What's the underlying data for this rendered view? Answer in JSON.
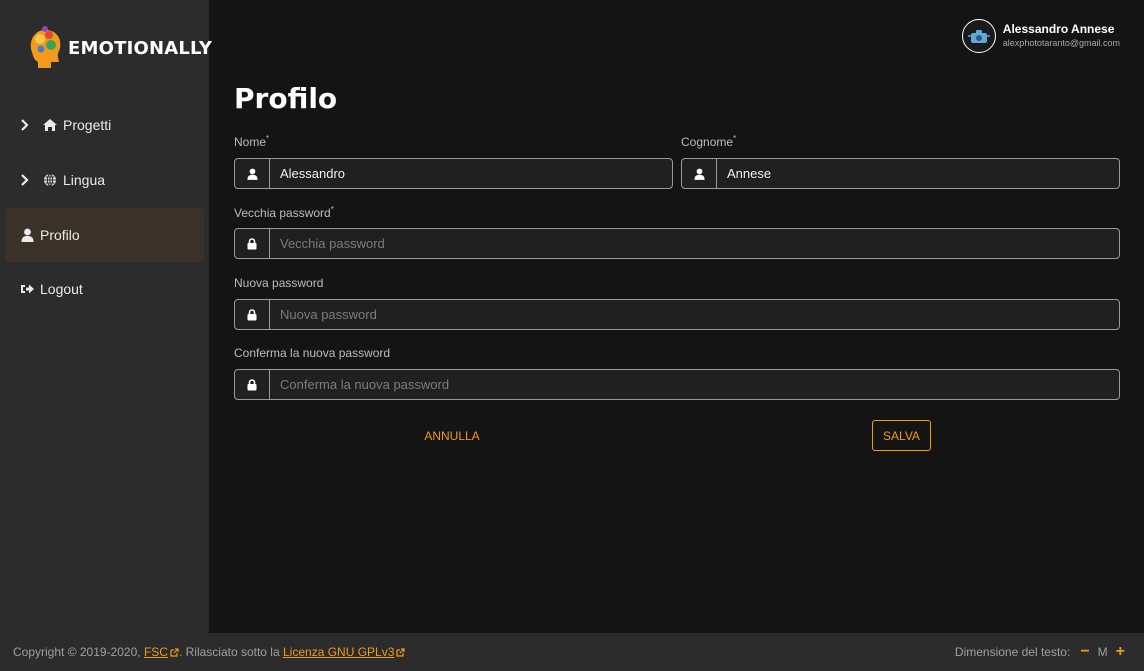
{
  "brand": {
    "name": "EMOTIONALLY"
  },
  "colors": {
    "accent": "#f29a1a",
    "sidebar_bg": "#2c2c2c",
    "page_bg": "#141414"
  },
  "sidebar": {
    "items": [
      {
        "label": "Progetti",
        "icon": "home-icon",
        "expandable": true
      },
      {
        "label": "Lingua",
        "icon": "globe-icon",
        "expandable": true
      },
      {
        "label": "Profilo",
        "icon": "user-icon",
        "active": true
      },
      {
        "label": "Logout",
        "icon": "sign-out-icon"
      }
    ]
  },
  "user": {
    "name": "Alessandro Annese",
    "email": "alexphototaranto@gmail.com"
  },
  "page": {
    "title": "Profilo"
  },
  "form": {
    "nome": {
      "label": "Nome",
      "required": "*",
      "value": "Alessandro"
    },
    "cognome": {
      "label": "Cognome",
      "required": "*",
      "value": "Annese"
    },
    "old_password": {
      "label": "Vecchia password",
      "required": "*",
      "placeholder": "Vecchia password"
    },
    "new_password": {
      "label": "Nuova password",
      "placeholder": "Nuova password"
    },
    "confirm_password": {
      "label": "Conferma la nuova password",
      "placeholder": "Conferma la nuova password"
    },
    "cancel_label": "ANNULLA",
    "save_label": "SALVA"
  },
  "footer": {
    "copyright": "Copyright © 2019-2020,",
    "fsc_link": "FSC",
    "released": ". Rilasciato sotto la",
    "license_link": "Licenza GNU GPLv3",
    "text_size_label": "Dimensione del testo:",
    "decrease": "−",
    "size_value": "M",
    "increase": "+"
  }
}
